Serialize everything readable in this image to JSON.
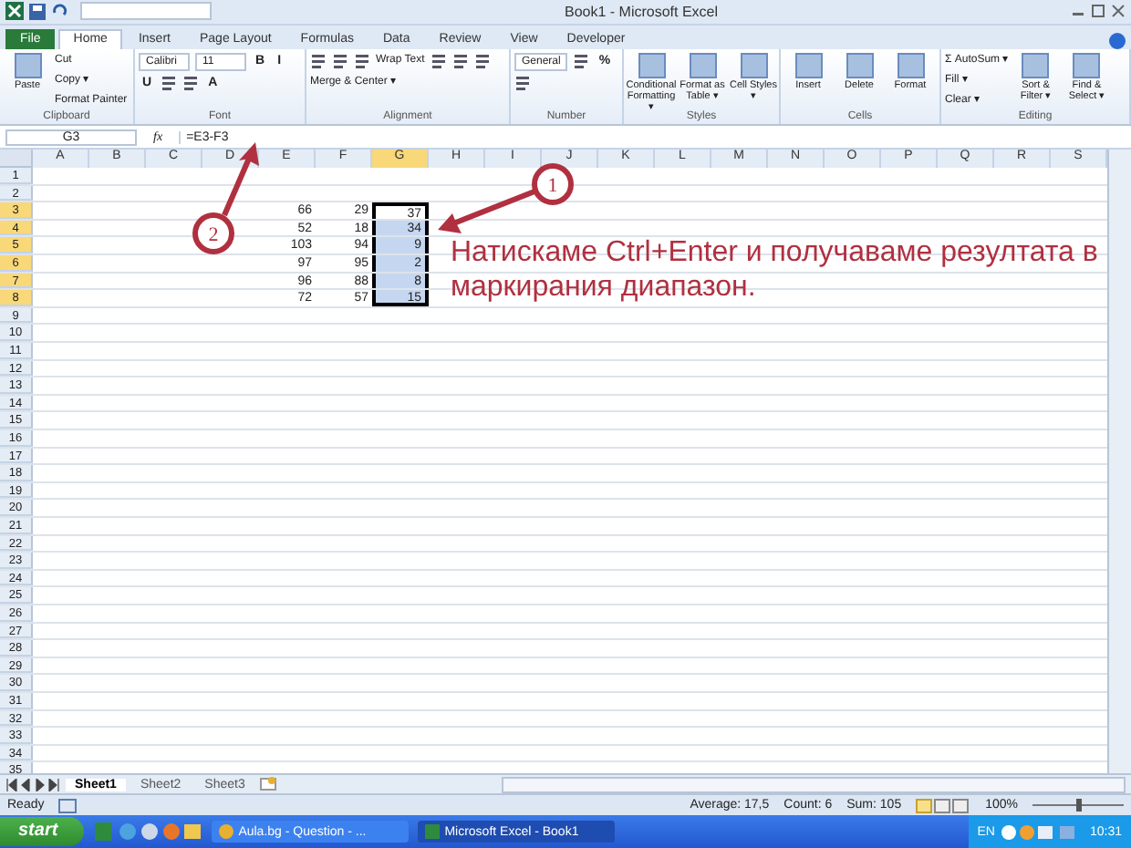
{
  "window": {
    "title": "Book1 - Microsoft Excel"
  },
  "tabs": [
    {
      "label": "File",
      "selected": false,
      "kind": "file"
    },
    {
      "label": "Home",
      "selected": true,
      "kind": "tab"
    },
    {
      "label": "Insert",
      "selected": false,
      "kind": "tab"
    },
    {
      "label": "Page Layout",
      "selected": false,
      "kind": "tab"
    },
    {
      "label": "Formulas",
      "selected": false,
      "kind": "tab"
    },
    {
      "label": "Data",
      "selected": false,
      "kind": "tab"
    },
    {
      "label": "Review",
      "selected": false,
      "kind": "tab"
    },
    {
      "label": "View",
      "selected": false,
      "kind": "tab"
    },
    {
      "label": "Developer",
      "selected": false,
      "kind": "tab"
    }
  ],
  "ribbon": [
    {
      "label": "Clipboard",
      "items": [
        {
          "kind": "large",
          "label": "Paste"
        },
        {
          "kind": "small",
          "label": "Cut"
        },
        {
          "kind": "small",
          "label": "Copy ▾"
        },
        {
          "kind": "small",
          "label": "Format Painter"
        }
      ]
    },
    {
      "label": "Font",
      "items": [
        {
          "kind": "field",
          "label": "Calibri"
        },
        {
          "kind": "field",
          "label": "11"
        },
        {
          "kind": "text",
          "label": "B"
        },
        {
          "kind": "text",
          "label": "I"
        },
        {
          "kind": "text",
          "label": "U"
        },
        {
          "kind": "icon"
        },
        {
          "kind": "icon"
        },
        {
          "kind": "text",
          "label": "A"
        }
      ]
    },
    {
      "label": "Alignment",
      "items": [
        {
          "kind": "icon"
        },
        {
          "kind": "icon"
        },
        {
          "kind": "icon"
        },
        {
          "kind": "small",
          "label": "Wrap Text"
        },
        {
          "kind": "icon"
        },
        {
          "kind": "icon"
        },
        {
          "kind": "icon"
        },
        {
          "kind": "small",
          "label": "Merge & Center ▾"
        }
      ]
    },
    {
      "label": "Number",
      "items": [
        {
          "kind": "field",
          "label": "General"
        },
        {
          "kind": "icon"
        },
        {
          "kind": "text",
          "label": "%"
        },
        {
          "kind": "icon"
        }
      ]
    },
    {
      "label": "Styles",
      "items": [
        {
          "kind": "large",
          "label": "Conditional Formatting ▾"
        },
        {
          "kind": "large",
          "label": "Format as Table ▾"
        },
        {
          "kind": "large",
          "label": "Cell Styles ▾"
        }
      ]
    },
    {
      "label": "Cells",
      "items": [
        {
          "kind": "large",
          "label": "Insert"
        },
        {
          "kind": "large",
          "label": "Delete"
        },
        {
          "kind": "large",
          "label": "Format"
        }
      ]
    },
    {
      "label": "Editing",
      "items": [
        {
          "kind": "small",
          "label": "Σ AutoSum ▾"
        },
        {
          "kind": "small",
          "label": "Fill ▾"
        },
        {
          "kind": "small",
          "label": "Clear ▾"
        },
        {
          "kind": "large",
          "label": "Sort & Filter ▾"
        },
        {
          "kind": "large",
          "label": "Find & Select ▾"
        }
      ]
    }
  ],
  "name_box": {
    "value": "G3"
  },
  "formula_bar": {
    "fx": "fx",
    "value": "=E3-F3"
  },
  "columns": [
    {
      "label": "A",
      "selected": false
    },
    {
      "label": "B",
      "selected": false
    },
    {
      "label": "C",
      "selected": false
    },
    {
      "label": "D",
      "selected": false
    },
    {
      "label": "E",
      "selected": false
    },
    {
      "label": "F",
      "selected": false
    },
    {
      "label": "G",
      "selected": true
    },
    {
      "label": "H",
      "selected": false
    },
    {
      "label": "I",
      "selected": false
    },
    {
      "label": "J",
      "selected": false
    },
    {
      "label": "K",
      "selected": false
    },
    {
      "label": "L",
      "selected": false
    },
    {
      "label": "M",
      "selected": false
    },
    {
      "label": "N",
      "selected": false
    },
    {
      "label": "O",
      "selected": false
    },
    {
      "label": "P",
      "selected": false
    },
    {
      "label": "Q",
      "selected": false
    },
    {
      "label": "R",
      "selected": false
    },
    {
      "label": "S",
      "selected": false
    }
  ],
  "rows": [
    {
      "header": "1",
      "selected": false
    },
    {
      "header": "2",
      "selected": false
    },
    {
      "header": "3",
      "selected": true,
      "cells": [
        {
          "value": "66",
          "selected": false
        },
        {
          "value": "29",
          "selected": false
        },
        {
          "value": "37",
          "selected": true
        }
      ]
    },
    {
      "header": "4",
      "selected": true,
      "cells": [
        {
          "value": "52",
          "selected": false
        },
        {
          "value": "18",
          "selected": false
        },
        {
          "value": "34",
          "selected": true
        }
      ]
    },
    {
      "header": "5",
      "selected": true,
      "cells": [
        {
          "value": "103",
          "selected": false
        },
        {
          "value": "94",
          "selected": false
        },
        {
          "value": "9",
          "selected": true
        }
      ]
    },
    {
      "header": "6",
      "selected": true,
      "cells": [
        {
          "value": "97",
          "selected": false
        },
        {
          "value": "95",
          "selected": false
        },
        {
          "value": "2",
          "selected": true
        }
      ]
    },
    {
      "header": "7",
      "selected": true,
      "cells": [
        {
          "value": "96",
          "selected": false
        },
        {
          "value": "88",
          "selected": false
        },
        {
          "value": "8",
          "selected": true
        }
      ]
    },
    {
      "header": "8",
      "selected": true,
      "cells": [
        {
          "value": "72",
          "selected": false
        },
        {
          "value": "57",
          "selected": false
        },
        {
          "value": "15",
          "selected": true
        }
      ]
    },
    {
      "header": "9",
      "selected": false
    },
    {
      "header": "10",
      "selected": false
    },
    {
      "header": "11",
      "selected": false
    },
    {
      "header": "12",
      "selected": false
    },
    {
      "header": "13",
      "selected": false
    },
    {
      "header": "14",
      "selected": false
    },
    {
      "header": "15",
      "selected": false
    },
    {
      "header": "16",
      "selected": false
    },
    {
      "header": "17",
      "selected": false
    },
    {
      "header": "18",
      "selected": false
    },
    {
      "header": "19",
      "selected": false
    },
    {
      "header": "20",
      "selected": false
    },
    {
      "header": "21",
      "selected": false
    },
    {
      "header": "22",
      "selected": false
    },
    {
      "header": "23",
      "selected": false
    },
    {
      "header": "24",
      "selected": false
    },
    {
      "header": "25",
      "selected": false
    },
    {
      "header": "26",
      "selected": false
    },
    {
      "header": "27",
      "selected": false
    },
    {
      "header": "28",
      "selected": false
    },
    {
      "header": "29",
      "selected": false
    },
    {
      "header": "30",
      "selected": false
    },
    {
      "header": "31",
      "selected": false
    },
    {
      "header": "32",
      "selected": false
    },
    {
      "header": "33",
      "selected": false
    },
    {
      "header": "34",
      "selected": false
    },
    {
      "header": "35",
      "selected": false
    }
  ],
  "annotation": {
    "text": "Натискаме Ctrl+Enter и получаваме резултата в маркирания диапазон.",
    "markers": [
      {
        "label": "1"
      },
      {
        "label": "2"
      }
    ]
  },
  "sheet_tabs": [
    {
      "label": "Sheet1",
      "selected": true
    },
    {
      "label": "Sheet2",
      "selected": false
    },
    {
      "label": "Sheet3",
      "selected": false
    }
  ],
  "status_bar": {
    "mode": "Ready",
    "average": "Average: 17,5",
    "count": "Count: 6",
    "sum": "Sum: 105",
    "zoom": "100%",
    "zoom_level": {
      "level": 0.5
    }
  },
  "taskbar": {
    "start": "start",
    "tasks": [
      {
        "label": "Aula.bg - Question - ...",
        "selected": false,
        "kind": "browser"
      },
      {
        "label": "Microsoft Excel - Book1",
        "selected": true,
        "kind": "excel"
      }
    ],
    "language": "EN",
    "clock": "10:31"
  }
}
